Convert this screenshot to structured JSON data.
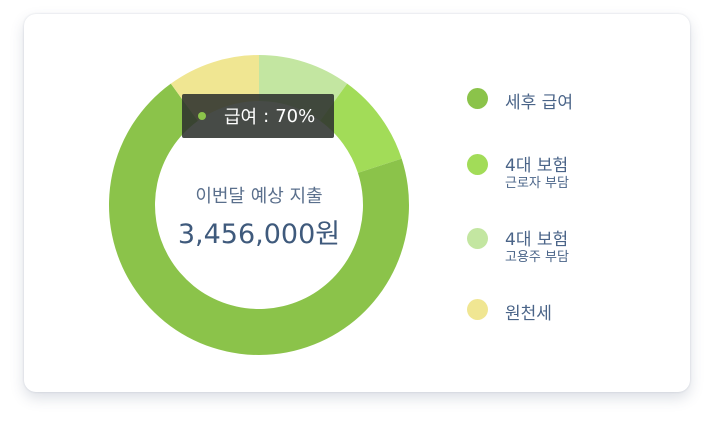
{
  "chart_data": {
    "type": "pie",
    "categories": [
      "세후 급여",
      "4대 보험 근로자 부담",
      "4대 보험 고용주 부담",
      "원천세"
    ],
    "values": [
      70,
      10,
      10,
      10
    ],
    "colors": [
      "#8bc34a",
      "#a2dc58",
      "#c3e6a1",
      "#f0e692"
    ],
    "center_title": "이번달 예상 지출",
    "center_value": "3,456,000원"
  },
  "tooltip": {
    "label": "급여",
    "separator": ":",
    "value": "70%"
  },
  "legend": [
    {
      "label": "세후 급여",
      "sub": "",
      "color": "#8bc34a"
    },
    {
      "label": "4대 보험",
      "sub": "근로자 부담",
      "color": "#a2dc58"
    },
    {
      "label": "4대 보험",
      "sub": "고용주 부담",
      "color": "#c3e6a1"
    },
    {
      "label": "원천세",
      "sub": "",
      "color": "#f0e692"
    }
  ]
}
